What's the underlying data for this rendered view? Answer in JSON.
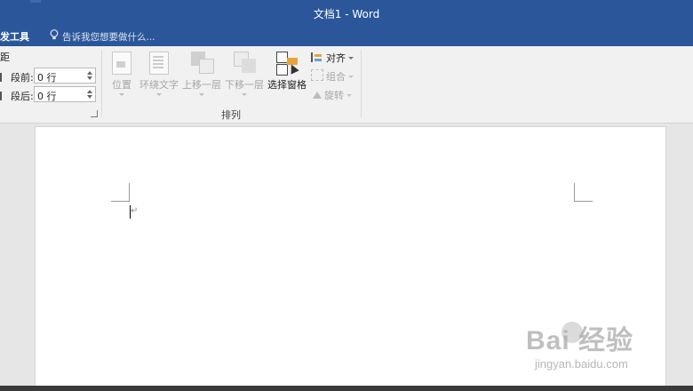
{
  "window": {
    "title": "文档1 - Word"
  },
  "tabs": {
    "active": "发工具",
    "tell_me": "告诉我您想要做什么..."
  },
  "spacing": {
    "title": "距",
    "before_label": "段前:",
    "before_value": "0 行",
    "after_label": "段后:",
    "after_value": "0 行"
  },
  "arrange": {
    "group_label": "排列",
    "position": "位置",
    "wrap_text": "环绕文字",
    "bring_forward": "上移一层",
    "send_backward": "下移一层",
    "selection_pane": "选择窗格",
    "align": "对齐",
    "group": "组合",
    "rotate": "旋转"
  },
  "document": {
    "paragraph_mark": "↵"
  },
  "watermark": {
    "brand": "Bai  经验",
    "site": "jingyan.baidu.com"
  },
  "colors": {
    "accent": "#2b579a",
    "ribbon": "#f1f1f1",
    "canvas": "#e6e6e6"
  }
}
